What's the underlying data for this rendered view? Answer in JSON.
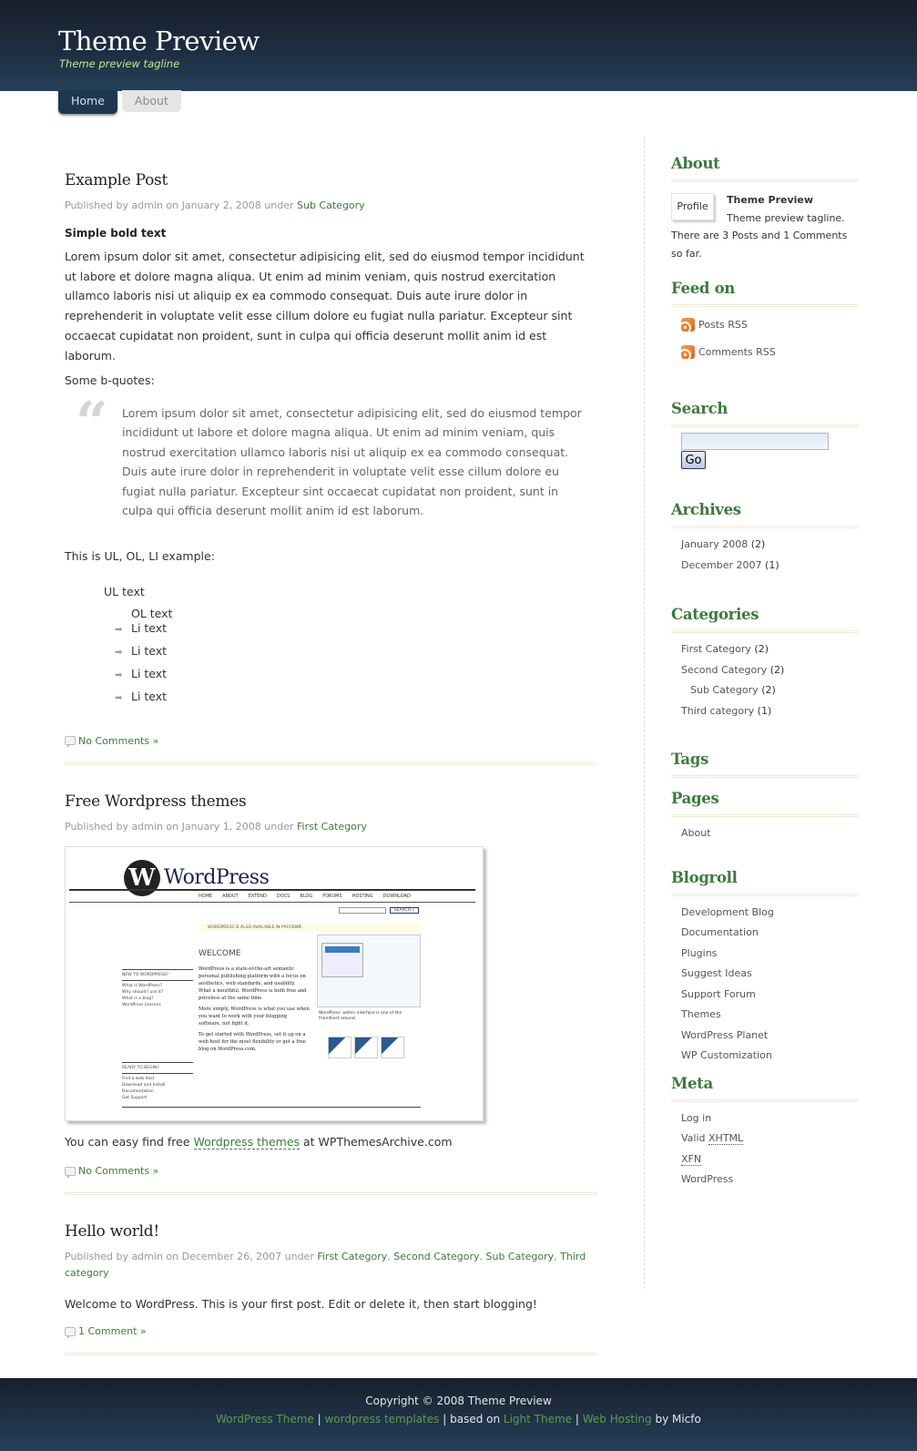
{
  "header": {
    "site_title": "Theme Preview",
    "tagline": "Theme preview tagline"
  },
  "nav": {
    "tabs": [
      {
        "label": "Home",
        "active": true
      },
      {
        "label": "About",
        "active": false
      }
    ]
  },
  "posts": [
    {
      "title": "Example Post",
      "meta_prefix": "Published by admin on January 2, 2008 under",
      "categories": [
        "Sub Category"
      ],
      "bold_text": "Simple bold text",
      "paragraph": "Lorem ipsum dolor sit amet, consectetur adipisicing elit, sed do eiusmod tempor incididunt ut labore et dolore magna aliqua. Ut enim ad minim veniam, quis nostrud exercitation ullamco laboris nisi ut aliquip ex ea commodo consequat. Duis aute irure dolor in reprehenderit in voluptate velit esse cillum dolore eu fugiat nulla pariatur. Excepteur sint occaecat cupidatat non proident, sunt in culpa qui officia deserunt mollit anim id est laborum.",
      "bquote_intro": "Some b-quotes:",
      "blockquote": "Lorem ipsum dolor sit amet, consectetur adipisicing elit, sed do eiusmod tempor incididunt ut labore et dolore magna aliqua. Ut enim ad minim veniam, quis nostrud exercitation ullamco laboris nisi ut aliquip ex ea commodo consequat. Duis aute irure dolor in reprehenderit in voluptate velit esse cillum dolore eu fugiat nulla pariatur. Excepteur sint occaecat cupidatat non proident, sunt in culpa qui officia deserunt mollit anim id est laborum.",
      "list_intro": "This is UL, OL, LI example:",
      "ul_text": "UL text",
      "ol_text": "OL text",
      "li_items": [
        "Li text",
        "Li text",
        "Li text",
        "Li text"
      ],
      "comments_link": "No Comments »"
    },
    {
      "title": "Free Wordpress themes",
      "meta_prefix": "Published by admin on January 1, 2008 under",
      "categories": [
        "First Category"
      ],
      "image_alt": "WordPress website screenshot",
      "image": {
        "logo_text": "WordPress",
        "nav": [
          "HOME",
          "ABOUT",
          "EXTEND",
          "DOCS",
          "BLOG",
          "FORUMS",
          "HOSTING",
          "DOWNLOAD"
        ],
        "search_btn": "SEARCH »",
        "notice": "WORDPRESS IS ALSO AVAILABLE IN РУССКИЙ.",
        "welcome": "WELCOME",
        "body": "WordPress is a state-of-the-art semantic personal publishing platform with a focus on aesthetics, web standards, and usability. What a mouthful. WordPress is both free and priceless at the same time.",
        "body2": "More simply, WordPress is what you use when you want to work with your blogging software, not fight it.",
        "body3": "To get started with WordPress, set it up on a web host for the most flexibility or get a free blog on WordPress.com.",
        "side1_title": "NEW TO WORDPRESS?",
        "side1_items": [
          "What is WordPress?",
          "Why should I use it?",
          "What is a blog?",
          "WordPress Lessons"
        ],
        "side2_title": "READY TO BEGIN?",
        "side2_items": [
          "Find a web host",
          "Download and Install",
          "Documentation",
          "Get Support"
        ],
        "caption": "WordPress' admin interface is one of the friendliest around."
      },
      "text_before": "You can easy find free",
      "text_link": "Wordpress themes",
      "text_after": "at WPThemesArchive.com",
      "comments_link": "No Comments »"
    },
    {
      "title": "Hello world!",
      "meta_prefix": "Published by admin on December 26, 2007 under",
      "categories": [
        "First Category",
        "Second Category",
        "Sub Category",
        "Third category"
      ],
      "paragraph": "Welcome to WordPress. This is your first post. Edit or delete it, then start blogging!",
      "comments_link": "1 Comment »"
    }
  ],
  "sidebar": {
    "about": {
      "title": "About",
      "profile_label": "Profile",
      "name": "Theme Preview",
      "tagline": "Theme preview tagline.",
      "stats": "There are 3 Posts and 1 Comments so far."
    },
    "feed": {
      "title": "Feed on",
      "items": [
        "Posts RSS",
        "Comments RSS"
      ]
    },
    "search": {
      "title": "Search",
      "input_value": "",
      "button_label": "Go"
    },
    "archives": {
      "title": "Archives",
      "items": [
        {
          "label": "January 2008",
          "count": "(2)"
        },
        {
          "label": "December 2007",
          "count": "(1)"
        }
      ]
    },
    "categories": {
      "title": "Categories",
      "items": [
        {
          "label": "First Category",
          "count": "(2)",
          "sub": false
        },
        {
          "label": "Second Category",
          "count": "(2)",
          "sub": false
        },
        {
          "label": "Sub Category",
          "count": "(2)",
          "sub": true
        },
        {
          "label": "Third category",
          "count": "(1)",
          "sub": false
        }
      ]
    },
    "tags": {
      "title": "Tags"
    },
    "pages": {
      "title": "Pages",
      "items": [
        "About"
      ]
    },
    "blogroll": {
      "title": "Blogroll",
      "items": [
        "Development Blog",
        "Documentation",
        "Plugins",
        "Suggest Ideas",
        "Support Forum",
        "Themes",
        "WordPress Planet",
        "WP Customization"
      ]
    },
    "meta": {
      "title": "Meta",
      "log_in": "Log in",
      "valid_prefix": "Valid",
      "xhtml": "XHTML",
      "xfn": "XFN",
      "wordpress": "WordPress"
    }
  },
  "footer": {
    "copyright": "Copyright © 2008 Theme Preview",
    "links": [
      "WordPress Theme",
      "wordpress templates",
      "Light Theme",
      "Web Hosting"
    ],
    "separator": "|",
    "based_on": "based on",
    "by": "by Micfo"
  },
  "colors": {
    "accent_green": "#3c7a3c",
    "header_dark": "#1d2d40",
    "tagline": "#c8e98a"
  }
}
